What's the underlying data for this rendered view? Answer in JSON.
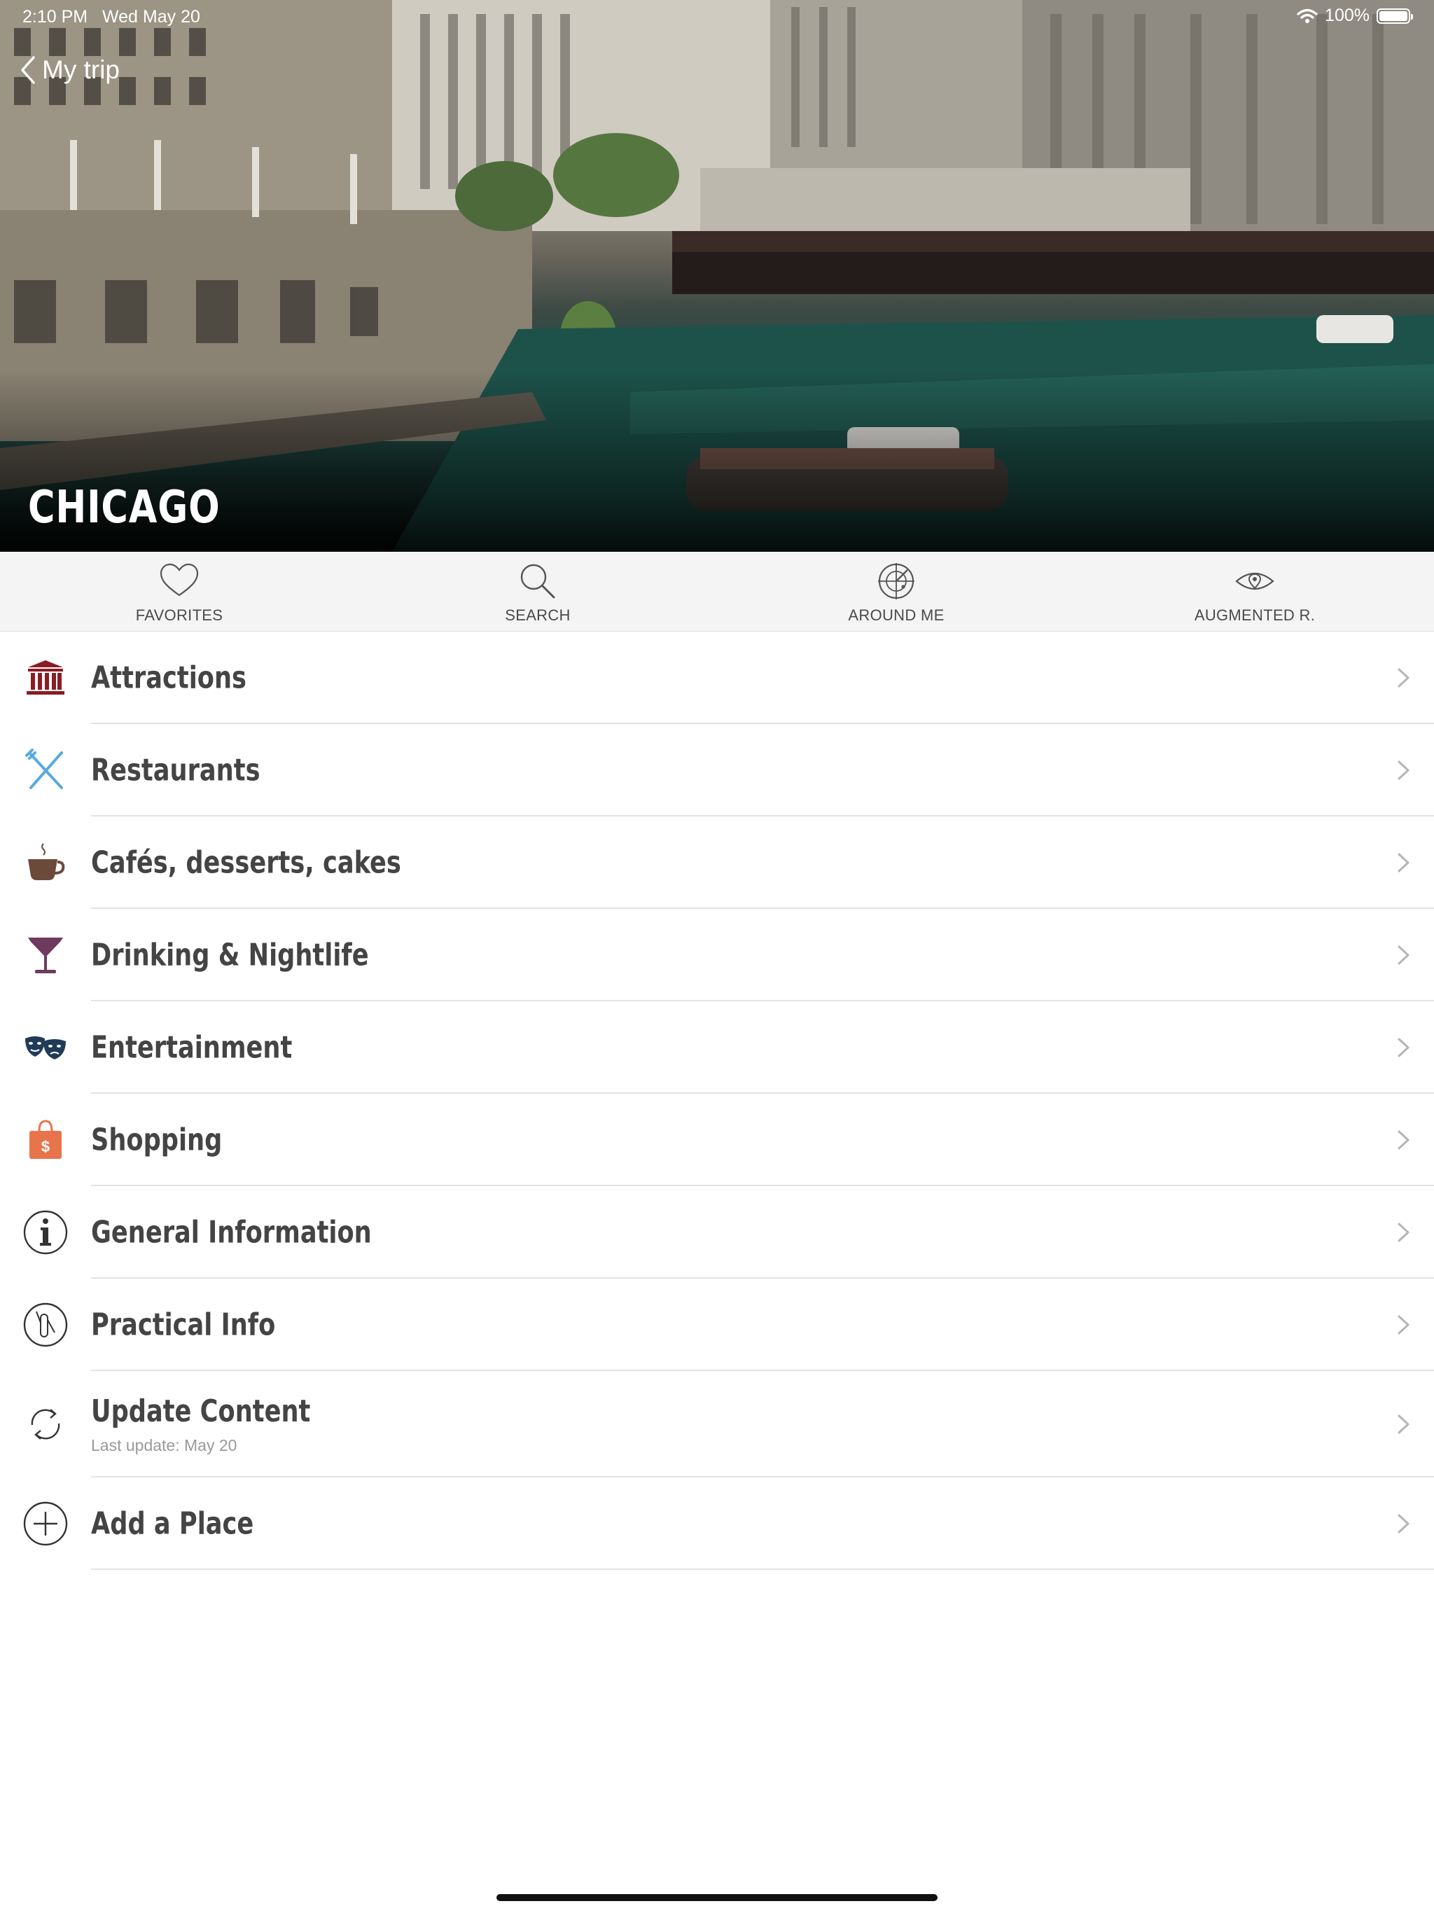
{
  "status_bar": {
    "time": "2:10 PM",
    "date": "Wed May 20",
    "battery": "100%",
    "battery_level": 1.0
  },
  "nav": {
    "back_label": "My trip"
  },
  "hero": {
    "title": "CHICAGO"
  },
  "toolbar": [
    {
      "label": "FAVORITES",
      "icon": "heart-icon"
    },
    {
      "label": "SEARCH",
      "icon": "search-icon"
    },
    {
      "label": "AROUND ME",
      "icon": "radar-icon"
    },
    {
      "label": "AUGMENTED R.",
      "icon": "eye-pin-icon"
    }
  ],
  "menu": [
    {
      "label": "Attractions",
      "icon": "museum-icon",
      "color": "#8a1c24"
    },
    {
      "label": "Restaurants",
      "icon": "fork-knife-icon",
      "color": "#5aa9dd"
    },
    {
      "label": "Cafés, desserts, cakes",
      "icon": "coffee-cup-icon",
      "color": "#6b4a3a"
    },
    {
      "label": "Drinking & Nightlife",
      "icon": "cocktail-icon",
      "color": "#6e3a5e"
    },
    {
      "label": "Entertainment",
      "icon": "theater-masks-icon",
      "color": "#1f3b57"
    },
    {
      "label": "Shopping",
      "icon": "shopping-bag-icon",
      "color": "#e8744c"
    },
    {
      "label": "General Information",
      "icon": "info-icon",
      "color": "#333333"
    },
    {
      "label": "Practical Info",
      "icon": "pocket-knife-icon",
      "color": "#333333"
    },
    {
      "label": "Update Content",
      "sub": "Last update: May 20",
      "icon": "refresh-icon",
      "color": "#333333"
    },
    {
      "label": "Add a Place",
      "icon": "add-circle-icon",
      "color": "#333333"
    }
  ]
}
